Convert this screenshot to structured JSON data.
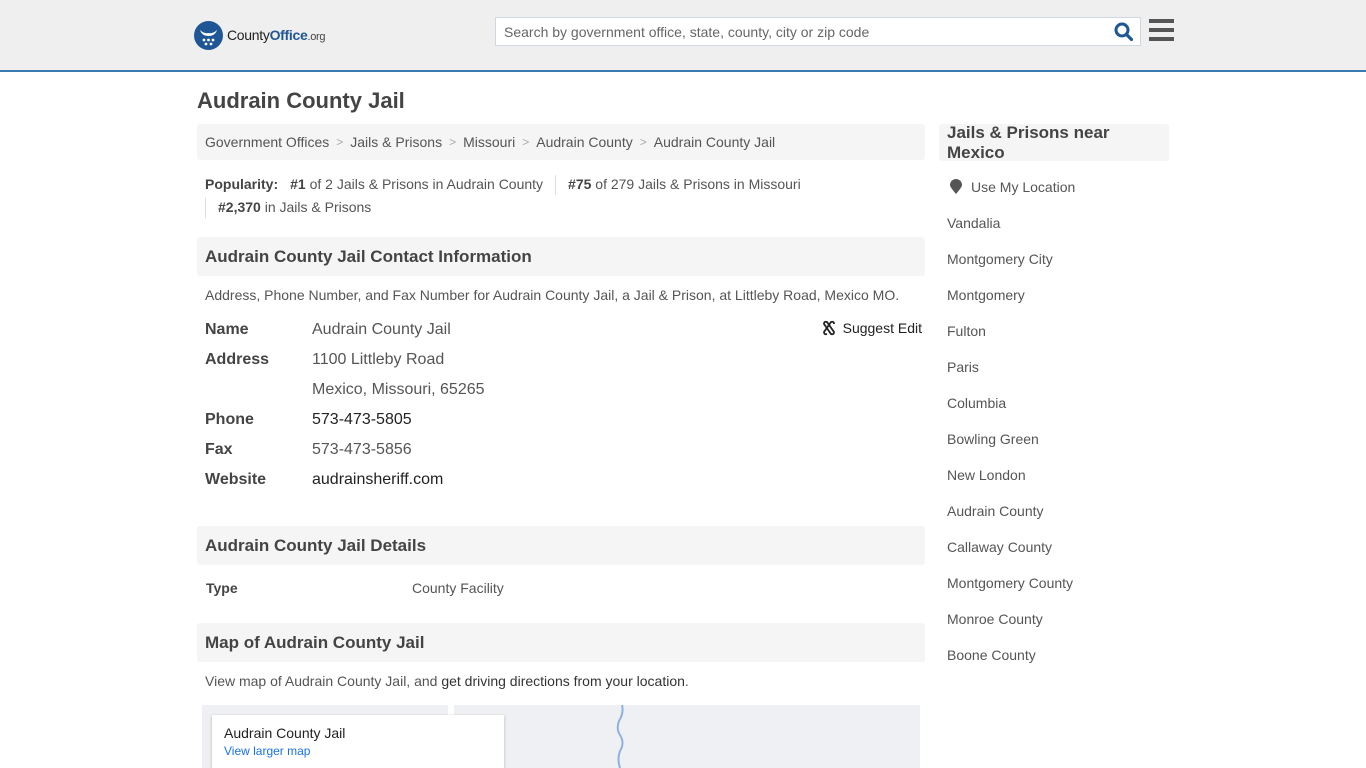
{
  "header": {
    "logo": {
      "prefix": "County",
      "brand": "Office",
      "suffix": ".org"
    },
    "search": {
      "placeholder": "Search by government office, state, county, city or zip code",
      "value": ""
    },
    "search_icon": "search-icon",
    "menu_icon": "hamburger-menu-icon"
  },
  "page": {
    "title": "Audrain County Jail"
  },
  "breadcrumb": [
    {
      "label": "Government Offices"
    },
    {
      "label": "Jails & Prisons"
    },
    {
      "label": "Missouri"
    },
    {
      "label": "Audrain County"
    },
    {
      "label": "Audrain County Jail"
    }
  ],
  "popularity": {
    "label": "Popularity:",
    "items": [
      {
        "rank": "#1",
        "text": " of 2 Jails & Prisons in Audrain County"
      },
      {
        "rank": "#75",
        "text": " of 279 Jails & Prisons in Missouri"
      },
      {
        "rank": "#2,370",
        "text": " in Jails & Prisons"
      }
    ]
  },
  "contact": {
    "heading": "Audrain County Jail Contact Information",
    "description": "Address, Phone Number, and Fax Number for Audrain County Jail, a Jail & Prison, at Littleby Road, Mexico MO.",
    "suggest_edit": "Suggest Edit",
    "rows": {
      "name_label": "Name",
      "name": "Audrain County Jail",
      "address_label": "Address",
      "address_line1": "1100 Littleby Road",
      "address_line2": "Mexico, Missouri, 65265",
      "phone_label": "Phone",
      "phone": "573-473-5805",
      "fax_label": "Fax",
      "fax": "573-473-5856",
      "website_label": "Website",
      "website": "audrainsheriff.com"
    }
  },
  "details": {
    "heading": "Audrain County Jail Details",
    "type_label": "Type",
    "type_value": "County Facility"
  },
  "map_section": {
    "heading": "Map of Audrain County Jail",
    "desc_prefix": "View map of Audrain County Jail, and ",
    "desc_link": "get driving directions from your location",
    "desc_suffix": ".",
    "card_title": "Audrain County Jail",
    "card_link": "View larger map"
  },
  "sidebar": {
    "heading": "Jails & Prisons near Mexico",
    "use_location": "Use My Location",
    "links": [
      "Vandalia",
      "Montgomery City",
      "Montgomery",
      "Fulton",
      "Paris",
      "Columbia",
      "Bowling Green",
      "New London",
      "Audrain County",
      "Callaway County",
      "Montgomery County",
      "Monroe County",
      "Boone County"
    ]
  },
  "colors": {
    "brand_blue": "#1f5796",
    "header_border": "#3a7ab0",
    "header_bg": "#efefef",
    "section_bg": "#f5f5f5",
    "map_link": "#1a73e8"
  }
}
